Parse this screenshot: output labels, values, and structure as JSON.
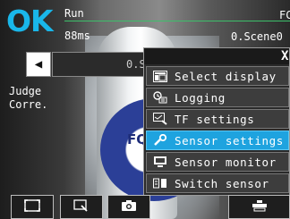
{
  "status": {
    "result": "OK",
    "mode": "Run",
    "time": "88ms",
    "corner_label": "FC",
    "scene": "0.Scene0"
  },
  "nav": {
    "back_icon": "◀",
    "scene_bar_text": "0.S"
  },
  "readout": {
    "judge_label": "Judge",
    "corr_label": "Corre."
  },
  "camera": {
    "label_text": "FQ"
  },
  "menu": {
    "close_label": "X",
    "items": [
      {
        "label": "Select display",
        "icon": "display-select-icon"
      },
      {
        "label": "Logging",
        "icon": "logging-icon"
      },
      {
        "label": "TF settings",
        "icon": "tf-settings-icon"
      },
      {
        "label": "Sensor settings",
        "icon": "wrench-icon",
        "active": true
      },
      {
        "label": "Sensor monitor",
        "icon": "monitor-icon"
      },
      {
        "label": "Switch sensor",
        "icon": "switch-sensor-icon"
      }
    ]
  },
  "toolbar": {
    "buttons": [
      "fullscreen-icon",
      "zoom-icon",
      "camera-icon",
      "menu-toggle-icon"
    ]
  },
  "colors": {
    "ok": "#19b7ea",
    "active_item": "#1ea3df",
    "status_line": "#3cc06a"
  }
}
